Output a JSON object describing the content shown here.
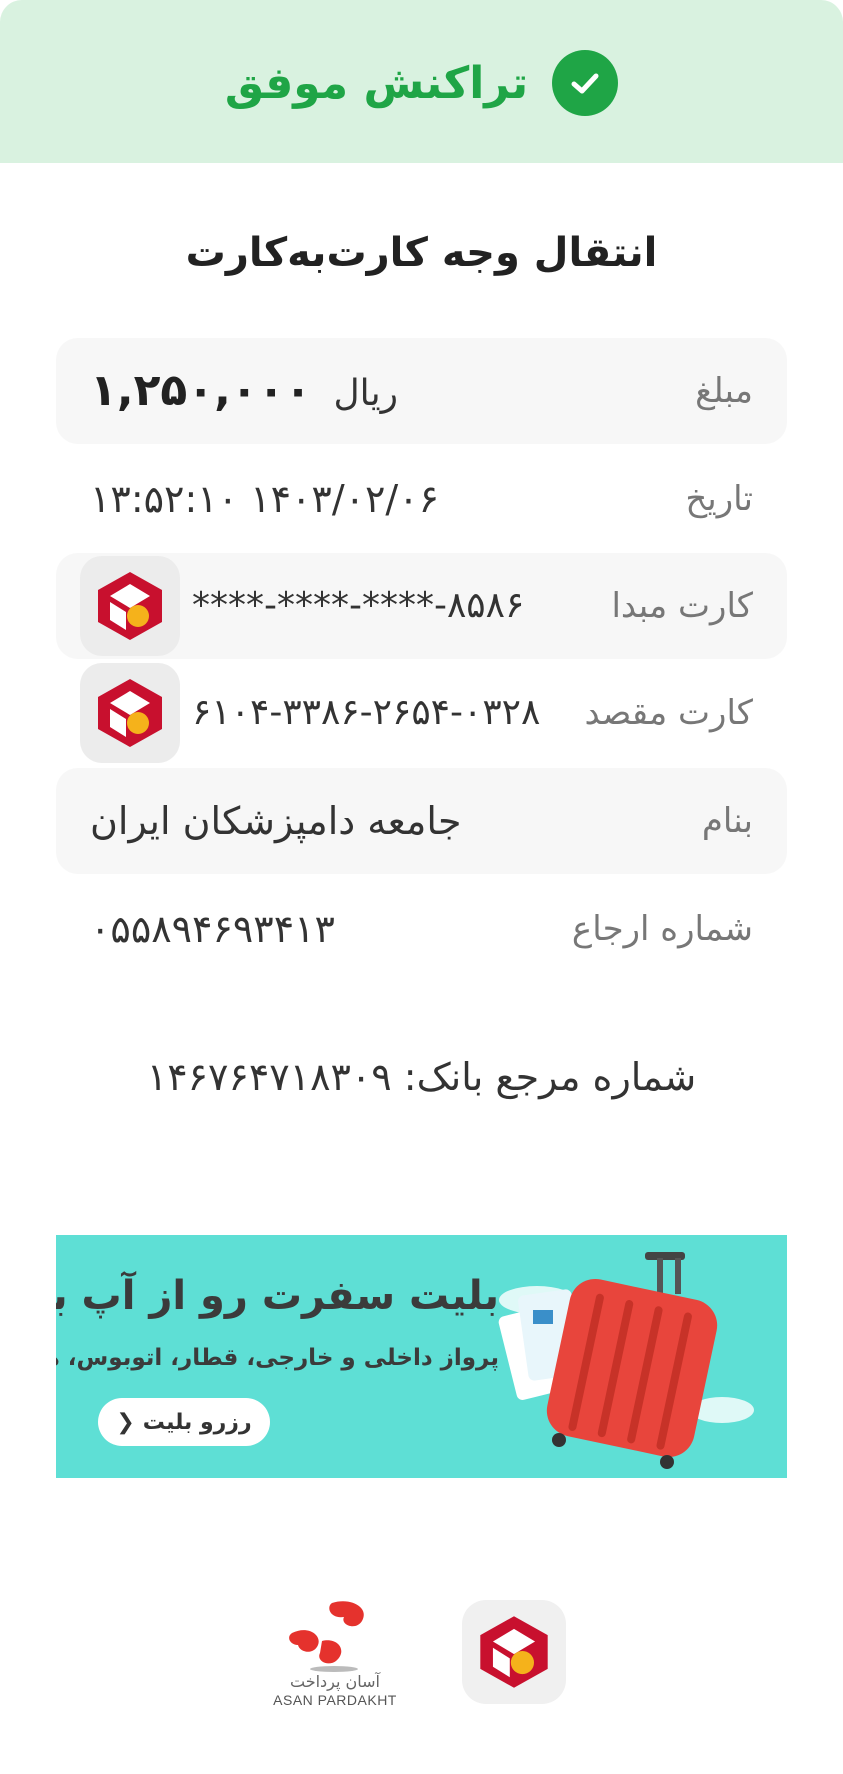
{
  "header": {
    "status": "تراکنش موفق",
    "status_icon": "check-circle-icon",
    "bg_color": "#d9f2e0",
    "accent_color": "#1fa546"
  },
  "title": "انتقال وجه کارت‌به‌کارت",
  "rows": {
    "amount": {
      "label": "مبلغ",
      "value": "۱,۲۵۰,۰۰۰",
      "unit": "ریال"
    },
    "date": {
      "label": "تاریخ",
      "value": "۱۴۰۳/۰۲/۰۶ ۱۳:۵۲:۱۰"
    },
    "source": {
      "label": "کارت مبدا",
      "value": "****-****-****-۸۵۸۶"
    },
    "dest": {
      "label": "کارت مقصد",
      "value": "۶۱۰۴-۳۳۸۶-۲۶۵۴-۰۳۲۸"
    },
    "name": {
      "label": "بنام",
      "value": "جامعه دامپزشکان ایران"
    },
    "ref": {
      "label": "شماره ارجاع",
      "value": "۰۵۵۸۹۴۶۹۳۴۱۳"
    }
  },
  "bank_ref": "شماره مرجع بانک: ۱۴۶۷۶۴۷۱۸۳۰۹",
  "banner": {
    "title": "بلیت سفرت رو از آپ بخر!",
    "subtitle": "پرواز داخلی و خارجی، قطار، اتوبوس، هتل",
    "button": "رزرو بلیت",
    "bg_color": "#5edfd5"
  },
  "footer": {
    "asan_label": "ASAN PARDAKHT",
    "bank_icon": "mellat-bank-logo-icon"
  }
}
